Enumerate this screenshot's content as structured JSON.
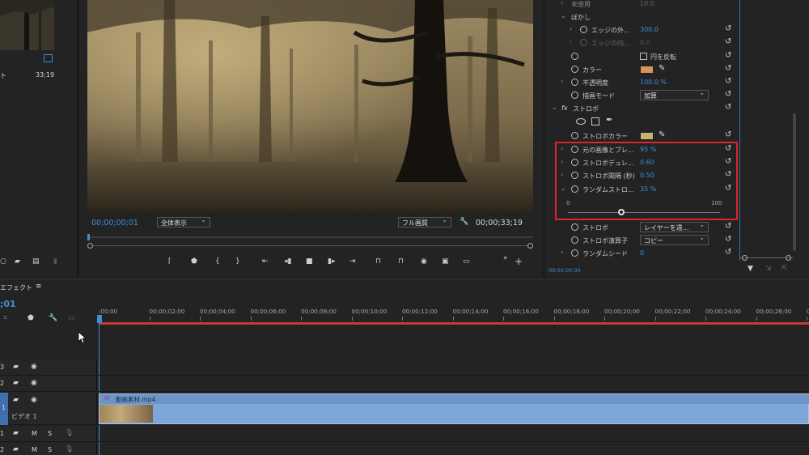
{
  "project": {
    "item_label": "ト",
    "item_duration": "33;19"
  },
  "monitor": {
    "playhead_time": "00;00;00;01",
    "zoom_select": "全体表示",
    "quality_select": "フル画質",
    "duration": "00;00;33;19"
  },
  "effects": {
    "rows": {
      "unused": {
        "label": "未使用",
        "value": "10.0"
      },
      "blur_group": {
        "label": "ぼかし"
      },
      "edge_outer": {
        "label": "エッジの外...",
        "value": "300.0"
      },
      "edge_inner": {
        "label": "エッジの内...",
        "value": "0.0"
      },
      "invert": {
        "label": "円を反転"
      },
      "color": {
        "label": "カラー",
        "swatch": "#d8955a"
      },
      "opacity": {
        "label": "不透明度",
        "value": "100.0 %"
      },
      "blend_mode": {
        "label": "描画モード",
        "value": "加算"
      },
      "strobe_header": {
        "fx": "fx",
        "label": "ストロボ"
      },
      "strobe_color": {
        "label": "ストロボカラー",
        "swatch": "#c9b170"
      },
      "blend_original": {
        "label": "元の画像とブレ...",
        "value": "95 %"
      },
      "strobe_duration": {
        "label": "ストロボデュレ...",
        "value": "0.60"
      },
      "strobe_period": {
        "label": "ストロボ間隔 (秒)",
        "value": "0.50"
      },
      "random_strobe": {
        "label": "ランダムストロ...",
        "value": "35 %"
      },
      "slider": {
        "min": "0",
        "max": "100",
        "level_percent": 35
      },
      "strobe": {
        "label": "ストロボ",
        "value": "レイヤーを違..."
      },
      "strobe_op": {
        "label": "ストロボ演算子",
        "value": "コピー"
      },
      "random_seed": {
        "label": "ランダムシード",
        "value": "0"
      }
    },
    "footer_time": "00;00;00;00"
  },
  "timeline": {
    "title": "エフェクト",
    "timecode": ";01",
    "ticks": [
      ";00;00",
      "00;00;02;00",
      "00;00;04;00",
      "00;00;06;00",
      "00;00;08;00",
      "00;00;10;00",
      "00;00;12;00",
      "00;00;14;00",
      "00;00;16;00",
      "00;00;18;00",
      "00;00;20;00",
      "00;00;22;00",
      "00;00;24;00",
      "00;00;26;00",
      "00;0"
    ],
    "tracks": {
      "v3": "3",
      "v2": "2",
      "v1": "1",
      "v1_name": "ビデオ 1",
      "a1": "1",
      "a2": "2",
      "mute": "M",
      "solo": "S"
    },
    "clip": {
      "fx": "fx",
      "name": "動画素材.mp4"
    }
  },
  "colors": {
    "accent": "#3f8fd8",
    "highlight_box": "#e0252a",
    "clip": "#7fa6d9",
    "playhead_line": "#c43a3a"
  }
}
